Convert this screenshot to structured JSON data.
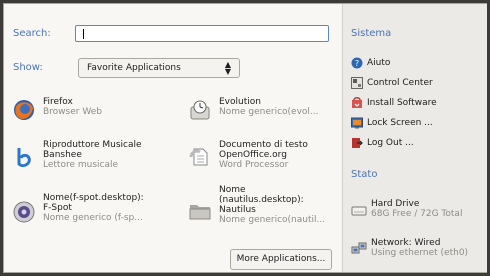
{
  "search": {
    "label": "Search:",
    "value": ""
  },
  "show": {
    "label": "Show:",
    "selected": "Favorite Applications"
  },
  "apps": [
    {
      "name": "Firefox",
      "desc": "Browser Web",
      "icon": "firefox-icon"
    },
    {
      "name": "Evolution",
      "desc": "Nome generico(evol...",
      "icon": "evolution-icon"
    },
    {
      "name": "Riproduttore Musicale",
      "name2": "Banshee",
      "desc": "Lettore musicale",
      "icon": "banshee-icon"
    },
    {
      "name": "Documento di testo",
      "name2": "OpenOffice.org",
      "desc": "Word Processor",
      "icon": "writer-icon"
    },
    {
      "name": "Nome(f-spot.desktop):",
      "name2": "F-Spot",
      "desc": "Nome generico (f-sp...",
      "icon": "fspot-icon"
    },
    {
      "name": "Nome",
      "name2": "(nautilus.desktop):",
      "name3": "Nautilus",
      "desc": "Nome generico(nautil...",
      "icon": "nautilus-icon"
    }
  ],
  "more_button": "More Applications...",
  "system": {
    "title": "Sistema",
    "items": [
      {
        "label": "Aiuto",
        "icon": "help-icon"
      },
      {
        "label": "Control Center",
        "icon": "control-center-icon"
      },
      {
        "label": "Install Software",
        "icon": "install-software-icon"
      },
      {
        "label": "Lock Screen ...",
        "icon": "lock-screen-icon"
      },
      {
        "label": "Log Out ...",
        "icon": "logout-icon"
      }
    ]
  },
  "status": {
    "title": "Stato",
    "drive": {
      "name": "Hard Drive",
      "desc": "68G Free / 72G Total"
    },
    "network": {
      "name": "Network: Wired",
      "desc": "Using ethernet (eth0)"
    }
  },
  "colors": {
    "accent": "#4a73b8",
    "muted": "#8e8c87"
  }
}
